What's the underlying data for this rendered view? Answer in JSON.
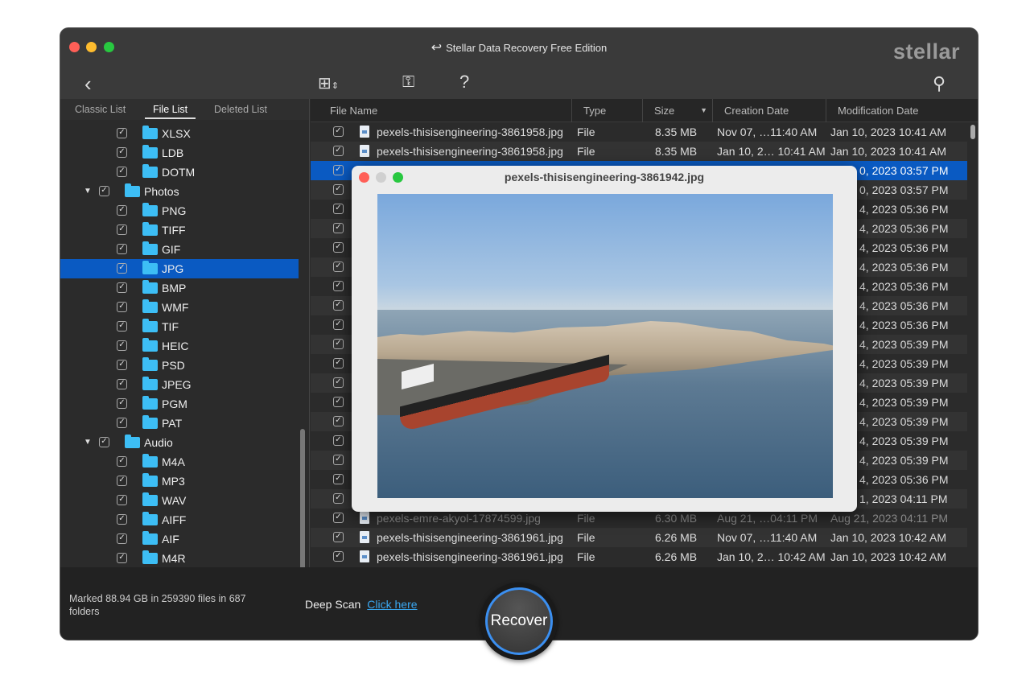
{
  "window": {
    "title": "Stellar Data Recovery Free Edition",
    "logo": "stellar",
    "traffic_lights": [
      "#ff5f57",
      "#febc2e",
      "#28c840"
    ]
  },
  "toolbar": {
    "back_icon": "chevron-left-icon",
    "view_icon": "grid-view-icon",
    "key_icon": "key-icon",
    "help_icon": "question-mark-icon",
    "search_icon": "search-icon"
  },
  "left_tabs": [
    {
      "label": "Classic List"
    },
    {
      "label": "File List",
      "active": true
    },
    {
      "label": "Deleted List"
    }
  ],
  "tree": [
    {
      "label": "XLSX",
      "level": 2
    },
    {
      "label": "LDB",
      "level": 2
    },
    {
      "label": "DOTM",
      "level": 2
    },
    {
      "label": "Photos",
      "level": 1,
      "expanded": true
    },
    {
      "label": "PNG",
      "level": 2
    },
    {
      "label": "TIFF",
      "level": 2
    },
    {
      "label": "GIF",
      "level": 2
    },
    {
      "label": "JPG",
      "level": 2,
      "selected": true
    },
    {
      "label": "BMP",
      "level": 2
    },
    {
      "label": "WMF",
      "level": 2
    },
    {
      "label": "TIF",
      "level": 2
    },
    {
      "label": "HEIC",
      "level": 2
    },
    {
      "label": "PSD",
      "level": 2
    },
    {
      "label": "JPEG",
      "level": 2
    },
    {
      "label": "PGM",
      "level": 2
    },
    {
      "label": "PAT",
      "level": 2
    },
    {
      "label": "Audio",
      "level": 1,
      "expanded": true
    },
    {
      "label": "M4A",
      "level": 2
    },
    {
      "label": "MP3",
      "level": 2
    },
    {
      "label": "WAV",
      "level": 2
    },
    {
      "label": "AIFF",
      "level": 2
    },
    {
      "label": "AIF",
      "level": 2
    },
    {
      "label": "M4R",
      "level": 2
    }
  ],
  "columns": [
    "File Name",
    "Type",
    "Size",
    "Creation Date",
    "Modification Date"
  ],
  "rows": [
    {
      "name": "pexels-thisisengineering-3861958.jpg",
      "type": "File",
      "size": "8.35 MB",
      "created": "Nov 07, …11:40 AM",
      "modified": "Jan 10, 2023 10:41 AM"
    },
    {
      "name": "pexels-thisisengineering-3861958.jpg",
      "type": "File",
      "size": "8.35 MB",
      "created": "Jan 10, 2… 10:41 AM",
      "modified": "Jan 10, 2023 10:41 AM"
    },
    {
      "modified": "0, 2023 03:57 PM",
      "selected": true,
      "partial": true
    },
    {
      "modified": "0, 2023 03:57 PM",
      "partial": true
    },
    {
      "modified": "4, 2023 05:36 PM",
      "partial": true
    },
    {
      "modified": "4, 2023 05:36 PM",
      "partial": true
    },
    {
      "modified": "4, 2023 05:36 PM",
      "partial": true
    },
    {
      "modified": "4, 2023 05:36 PM",
      "partial": true
    },
    {
      "modified": "4, 2023 05:36 PM",
      "partial": true
    },
    {
      "modified": "4, 2023 05:36 PM",
      "partial": true
    },
    {
      "modified": "4, 2023 05:36 PM",
      "partial": true
    },
    {
      "modified": "4, 2023 05:39 PM",
      "partial": true
    },
    {
      "modified": "4, 2023 05:39 PM",
      "partial": true
    },
    {
      "modified": "4, 2023 05:39 PM",
      "partial": true
    },
    {
      "modified": "4, 2023 05:39 PM",
      "partial": true
    },
    {
      "modified": "4, 2023 05:39 PM",
      "partial": true
    },
    {
      "modified": "4, 2023 05:39 PM",
      "partial": true
    },
    {
      "modified": "4, 2023 05:39 PM",
      "partial": true
    },
    {
      "modified": "4, 2023 05:36 PM",
      "partial": true
    },
    {
      "modified": "1, 2023 04:11 PM",
      "partial": true
    },
    {
      "name": "pexels-emre-akyol-17874599.jpg",
      "type": "File",
      "size": "6.30 MB",
      "created": "Aug 21, …04:11 PM",
      "modified": "Aug 21, 2023 04:11 PM",
      "dim": true
    },
    {
      "name": "pexels-thisisengineering-3861961.jpg",
      "type": "File",
      "size": "6.26 MB",
      "created": "Nov 07, …11:40 AM",
      "modified": "Jan 10, 2023 10:42 AM"
    },
    {
      "name": "pexels-thisisengineering-3861961.jpg",
      "type": "File",
      "size": "6.26 MB",
      "created": "Jan 10, 2… 10:42 AM",
      "modified": "Jan 10, 2023 10:42 AM"
    }
  ],
  "preview": {
    "title": "pexels-thisisengineering-3861942.jpg"
  },
  "footer": {
    "marked": "Marked 88.94 GB in 259390 files in 687 folders",
    "deep_scan": "Deep Scan",
    "click_here": "Click here",
    "recover": "Recover"
  },
  "colors": {
    "accent": "#0a5ac2",
    "folder": "#3dbef5",
    "link": "#3aa7f0",
    "recover_ring": "#3b8ff0"
  }
}
